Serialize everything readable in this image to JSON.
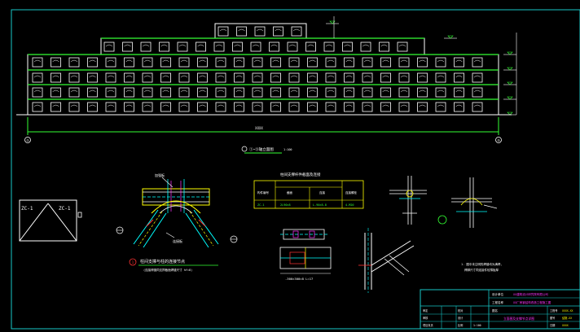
{
  "colors": {
    "background": "#000000",
    "frame": "#17c7c7",
    "building": "#ffffff",
    "floor": "#33ff33",
    "dim": "#ffffff",
    "cyan": "#00ffff",
    "yellow": "#ffff00",
    "magenta": "#ff33ff",
    "red": "#ff3333",
    "blue": "#3366ff"
  },
  "elevation": {
    "title": "①~⑤轴立面图",
    "scale": "1:100",
    "overall_dim": "XXXX",
    "axis_left": "①",
    "axis_right": "⑤"
  },
  "detail_zc": {
    "label_left": "ZC-1",
    "label_right": "ZC-1"
  },
  "detail_brace": {
    "tag_top": "加强板",
    "tag_side": "连接板",
    "caption": "柱间支撑与柱的连接节点",
    "caption_tag": "1",
    "note": "(连接焊缝同支撑截面焊缝尺寸 hf=8)"
  },
  "brace_table": {
    "title": "柱间支撑杆件截面及连接",
    "headers": [
      "构件编号",
      "截面",
      "连接",
      "连接螺栓"
    ],
    "row": [
      "ZC-1",
      "2L90×8",
      "L-90×8-8",
      "4-M20"
    ]
  },
  "plate_detail": {
    "dim_label": "-300×300×8 L=17"
  },
  "notes": {
    "line1": "1. 图中未注明的焊缝均为满焊,",
    "line2": "焊脚尺寸同连接件较薄板厚"
  },
  "title_block": {
    "row1_left": "设计单位",
    "row1_value": "XX建筑设计研究院有限公司",
    "row2_left": "工程名称",
    "row2_value": "XX厂房钢结构改造工程施工图",
    "drawing_label": "图名",
    "drawing_name": "立面图及支撑节点详图",
    "sheet_label1": "工程号",
    "sheet_value1": "XXXX-XX",
    "sheet_label2": "图号",
    "sheet_value2": "结施-XX",
    "sheet_label3": "日期",
    "sheet_value3": "XXXX",
    "role1": "审定",
    "role2": "审核",
    "role3": "项目负责",
    "role4": "专业负责",
    "role5": "校对",
    "role6": "设计",
    "role7": "比例",
    "scale_value": "1:100"
  },
  "icons": [
    "axis-bubble-icon",
    "section-mark-icon",
    "north-axis-icon"
  ]
}
